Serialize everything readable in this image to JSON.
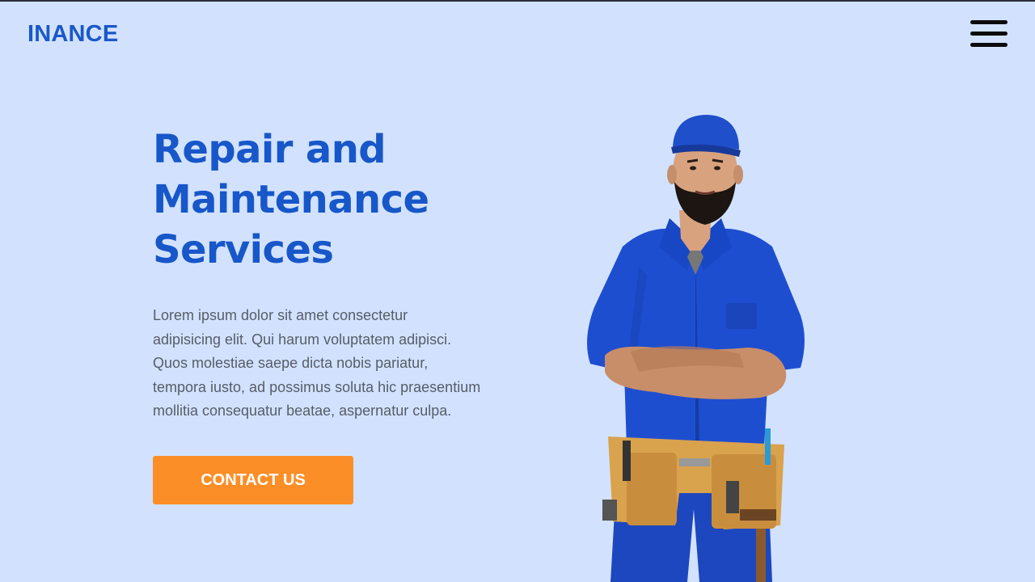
{
  "header": {
    "brand": "INANCE"
  },
  "hero": {
    "title": "Repair and\nMaintenance\nServices",
    "description": "Lorem ipsum dolor sit amet consectetur\nadipisicing elit. Qui harum voluptatem adipisci.\nQuos molestiae saepe dicta nobis pariatur,\ntempora iusto, ad possimus soluta hic praesentium\nmollitia consequatur beatae, aspernatur culpa.",
    "cta_label": "CONTACT US"
  },
  "colors": {
    "background": "#d2e2fe",
    "brand": "#1b58c8",
    "title": "#1757c9",
    "body_text": "#565d68",
    "cta": "#fc8e27"
  },
  "icons": {
    "menu": "hamburger-menu-icon"
  }
}
